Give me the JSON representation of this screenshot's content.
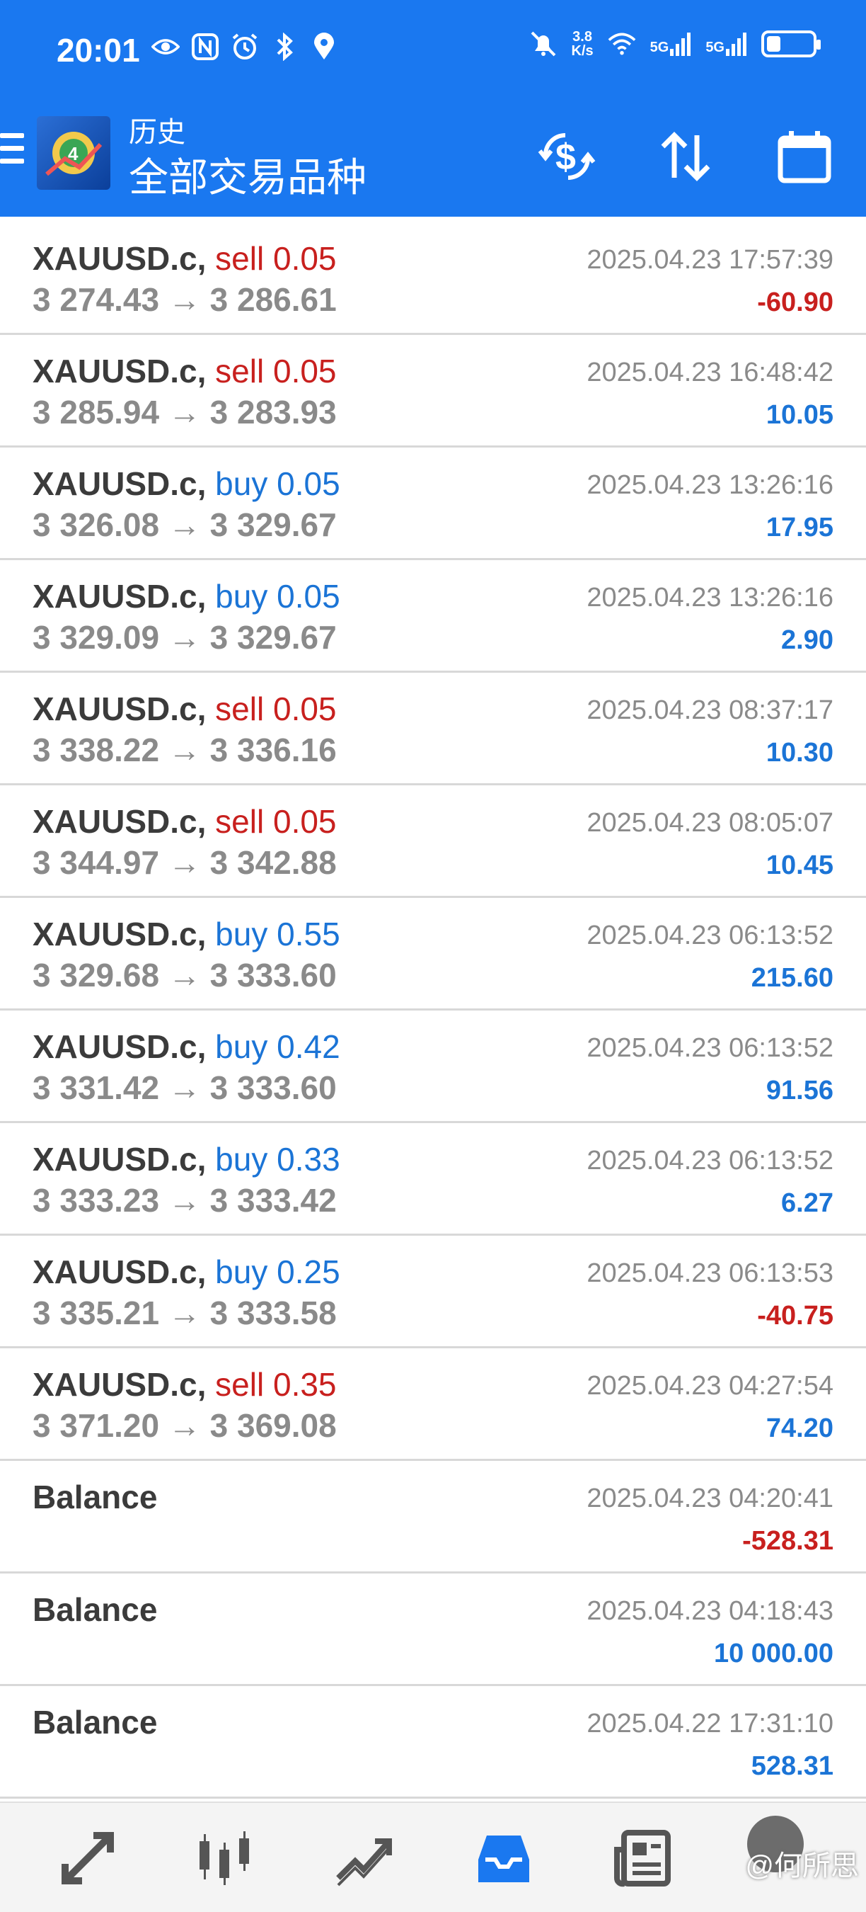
{
  "status_bar": {
    "time": "20:01",
    "net_speed_value": "3.8",
    "net_speed_unit": "K/s",
    "signal_label_1": "5G",
    "signal_label_2": "5G",
    "battery_level": 0.3
  },
  "app_bar": {
    "subtitle": "历史",
    "title": "全部交易品种"
  },
  "colors": {
    "primary": "#1a78f0",
    "sell": "#c8201e",
    "buy": "#1b74d6",
    "negative": "#c8201e",
    "positive": "#1b74d6",
    "muted": "#8a8a8a"
  },
  "trades": [
    {
      "symbol": "XAUUSD.c,",
      "direction": "sell",
      "volume": "0.05",
      "open": "3 274.43",
      "arrow": "→",
      "close": "3 286.61",
      "time": "2025.04.23 17:57:39",
      "profit": "-60.90"
    },
    {
      "symbol": "XAUUSD.c,",
      "direction": "sell",
      "volume": "0.05",
      "open": "3 285.94",
      "arrow": "→",
      "close": "3 283.93",
      "time": "2025.04.23 16:48:42",
      "profit": "10.05"
    },
    {
      "symbol": "XAUUSD.c,",
      "direction": "buy",
      "volume": "0.05",
      "open": "3 326.08",
      "arrow": "→",
      "close": "3 329.67",
      "time": "2025.04.23 13:26:16",
      "profit": "17.95"
    },
    {
      "symbol": "XAUUSD.c,",
      "direction": "buy",
      "volume": "0.05",
      "open": "3 329.09",
      "arrow": "→",
      "close": "3 329.67",
      "time": "2025.04.23 13:26:16",
      "profit": "2.90"
    },
    {
      "symbol": "XAUUSD.c,",
      "direction": "sell",
      "volume": "0.05",
      "open": "3 338.22",
      "arrow": "→",
      "close": "3 336.16",
      "time": "2025.04.23 08:37:17",
      "profit": "10.30"
    },
    {
      "symbol": "XAUUSD.c,",
      "direction": "sell",
      "volume": "0.05",
      "open": "3 344.97",
      "arrow": "→",
      "close": "3 342.88",
      "time": "2025.04.23 08:05:07",
      "profit": "10.45"
    },
    {
      "symbol": "XAUUSD.c,",
      "direction": "buy",
      "volume": "0.55",
      "open": "3 329.68",
      "arrow": "→",
      "close": "3 333.60",
      "time": "2025.04.23 06:13:52",
      "profit": "215.60"
    },
    {
      "symbol": "XAUUSD.c,",
      "direction": "buy",
      "volume": "0.42",
      "open": "3 331.42",
      "arrow": "→",
      "close": "3 333.60",
      "time": "2025.04.23 06:13:52",
      "profit": "91.56"
    },
    {
      "symbol": "XAUUSD.c,",
      "direction": "buy",
      "volume": "0.33",
      "open": "3 333.23",
      "arrow": "→",
      "close": "3 333.42",
      "time": "2025.04.23 06:13:52",
      "profit": "6.27"
    },
    {
      "symbol": "XAUUSD.c,",
      "direction": "buy",
      "volume": "0.25",
      "open": "3 335.21",
      "arrow": "→",
      "close": "3 333.58",
      "time": "2025.04.23 06:13:53",
      "profit": "-40.75"
    },
    {
      "symbol": "XAUUSD.c,",
      "direction": "sell",
      "volume": "0.35",
      "open": "3 371.20",
      "arrow": "→",
      "close": "3 369.08",
      "time": "2025.04.23 04:27:54",
      "profit": "74.20"
    }
  ],
  "balances": [
    {
      "label": "Balance",
      "time": "2025.04.23 04:20:41",
      "amount": "-528.31"
    },
    {
      "label": "Balance",
      "time": "2025.04.23 04:18:43",
      "amount": "10 000.00"
    },
    {
      "label": "Balance",
      "time": "2025.04.22 17:31:10",
      "amount": "528.31"
    }
  ],
  "bottom_nav": {
    "items": [
      "quotes-icon",
      "chart-candles-icon",
      "trade-icon",
      "history-icon",
      "news-icon",
      "chat-icon"
    ],
    "active_index": 3
  },
  "watermark": "@何所思"
}
